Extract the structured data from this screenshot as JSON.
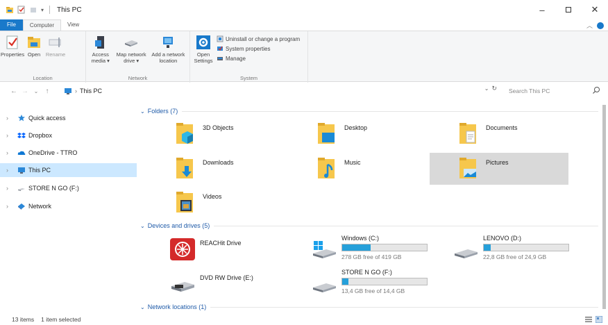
{
  "window": {
    "title": "This PC"
  },
  "tabs": [
    {
      "label": "File"
    },
    {
      "label": "Computer"
    },
    {
      "label": "View"
    }
  ],
  "ribbon": {
    "location": {
      "label": "Location",
      "buttons": [
        {
          "label": "Properties"
        },
        {
          "label": "Open"
        },
        {
          "label": "Rename"
        }
      ]
    },
    "network": {
      "label": "Network",
      "buttons": [
        {
          "label": "Access media ▾"
        },
        {
          "label": "Map network drive ▾"
        },
        {
          "label": "Add a network location"
        }
      ]
    },
    "system": {
      "label": "System",
      "open_settings": "Open Settings",
      "items": [
        {
          "label": "Uninstall or change a program"
        },
        {
          "label": "System properties"
        },
        {
          "label": "Manage"
        }
      ]
    }
  },
  "address": {
    "path": "This PC",
    "search_placeholder": "Search This PC"
  },
  "nav_pane": [
    {
      "label": "Quick access",
      "icon": "star-icon"
    },
    {
      "label": "Dropbox",
      "icon": "dropbox-icon"
    },
    {
      "label": "OneDrive - TTRO",
      "icon": "cloud-icon"
    },
    {
      "label": "This PC",
      "icon": "computer-icon",
      "selected": true
    },
    {
      "label": "STORE N GO (F:)",
      "icon": "usb-drive-icon"
    },
    {
      "label": "Network",
      "icon": "network-icon"
    }
  ],
  "folders": {
    "header": "Folders (7)",
    "items": [
      {
        "name": "3D Objects",
        "icon": "folder-3d-objects-icon"
      },
      {
        "name": "Desktop",
        "icon": "folder-desktop-icon"
      },
      {
        "name": "Documents",
        "icon": "folder-documents-icon"
      },
      {
        "name": "Downloads",
        "icon": "folder-downloads-icon"
      },
      {
        "name": "Music",
        "icon": "folder-music-icon"
      },
      {
        "name": "Pictures",
        "icon": "folder-pictures-icon",
        "selected": true
      },
      {
        "name": "Videos",
        "icon": "folder-videos-icon"
      }
    ]
  },
  "drives": {
    "header": "Devices and drives (5)",
    "items": [
      {
        "name": "REACHit Drive",
        "icon": "reachit-icon"
      },
      {
        "name": "Windows (C:)",
        "free": "278 GB free of 419 GB",
        "used_fraction": 0.34,
        "icon": "windows-drive-icon"
      },
      {
        "name": "LENOVO (D:)",
        "free": "22,8 GB free of 24,9 GB",
        "used_fraction": 0.08,
        "icon": "hard-drive-icon"
      },
      {
        "name": "DVD RW Drive (E:)",
        "icon": "dvd-drive-icon"
      },
      {
        "name": "STORE N GO (F:)",
        "free": "13,4 GB free of 14,4 GB",
        "used_fraction": 0.07,
        "icon": "usb-drive-icon"
      }
    ]
  },
  "network_locations": {
    "header": "Network locations (1)"
  },
  "status": {
    "items_count": "13 items",
    "selected": "1 item selected"
  },
  "colors": {
    "accent": "#1979ca",
    "selection": "#cce8ff",
    "drive_bar": "#26a0da",
    "folder": "#f6c74c"
  }
}
